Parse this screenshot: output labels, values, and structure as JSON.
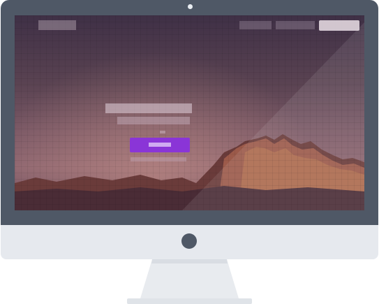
{
  "colors": {
    "bezel": "#4f5866",
    "chin": "#e6e9ee",
    "stand": "#e8ebef",
    "cta_button": "#8a35d7",
    "sky_top": "#3f3046",
    "mountain": "#8a4a44"
  },
  "device": {
    "camera_icon": "camera-dot",
    "home_icon": "home-button-circle"
  },
  "website": {
    "nav": {
      "logo": "",
      "links": [
        "",
        ""
      ],
      "cta": ""
    },
    "hero": {
      "title": "",
      "subtitle": "",
      "button": "",
      "link": ""
    }
  }
}
